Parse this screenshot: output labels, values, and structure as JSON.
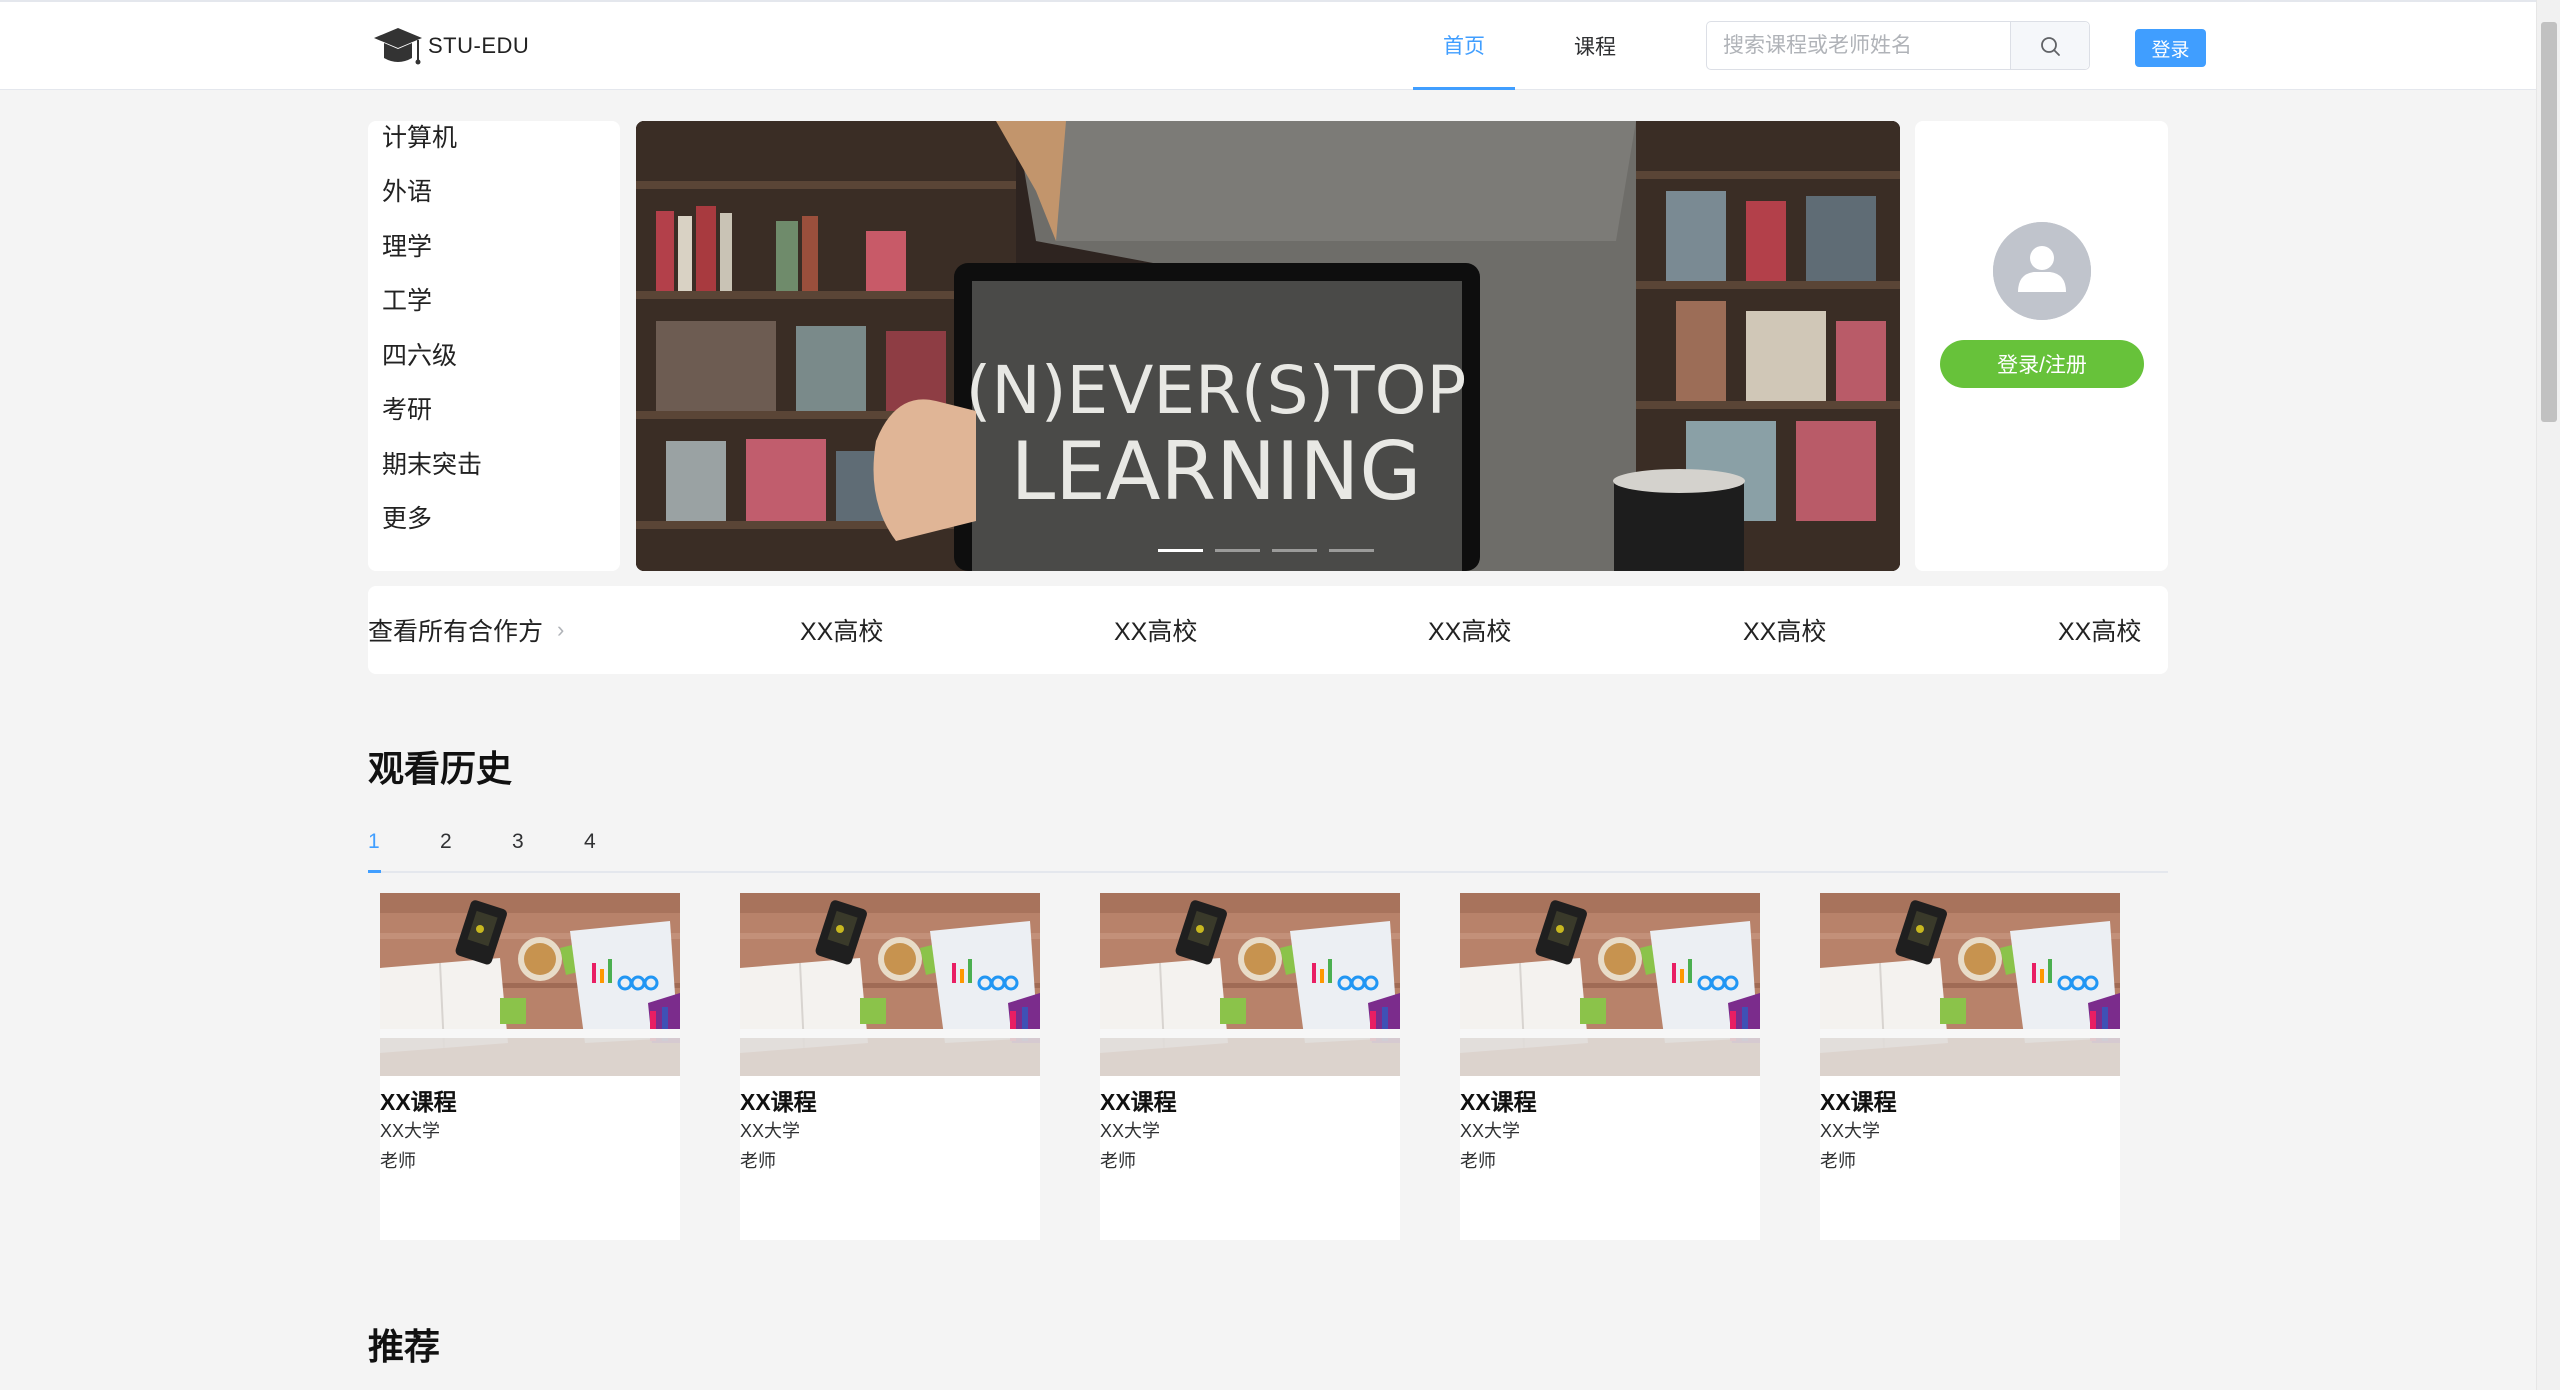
{
  "header": {
    "logo_text": "STU-EDU",
    "nav": {
      "home": "首页",
      "courses": "课程"
    },
    "search_placeholder": "搜索课程或老师姓名",
    "login": "登录",
    "accent_color": "#409eff"
  },
  "categories": [
    "计算机",
    "外语",
    "理学",
    "工学",
    "四六级",
    "考研",
    "期末突击",
    "更多"
  ],
  "banner": {
    "chalkboard_line1": "(N)EVER(S)TOP",
    "chalkboard_line2": "LEARNING",
    "slide_count": 4,
    "active_slide": 1
  },
  "user_card": {
    "register_button": "登录/注册",
    "button_color": "#67c23a"
  },
  "partners": {
    "view_all": "查看所有合作方",
    "items": [
      "XX高校",
      "XX高校",
      "XX高校",
      "XX高校",
      "XX高校"
    ]
  },
  "history": {
    "title": "观看历史",
    "tabs": [
      "1",
      "2",
      "3",
      "4"
    ],
    "active_tab": "1",
    "courses": [
      {
        "name": "XX课程",
        "school": "XX大学",
        "teacher": "老师"
      },
      {
        "name": "XX课程",
        "school": "XX大学",
        "teacher": "老师"
      },
      {
        "name": "XX课程",
        "school": "XX大学",
        "teacher": "老师"
      },
      {
        "name": "XX课程",
        "school": "XX大学",
        "teacher": "老师"
      },
      {
        "name": "XX课程",
        "school": "XX大学",
        "teacher": "老师"
      }
    ]
  },
  "recommend": {
    "title": "推荐"
  }
}
